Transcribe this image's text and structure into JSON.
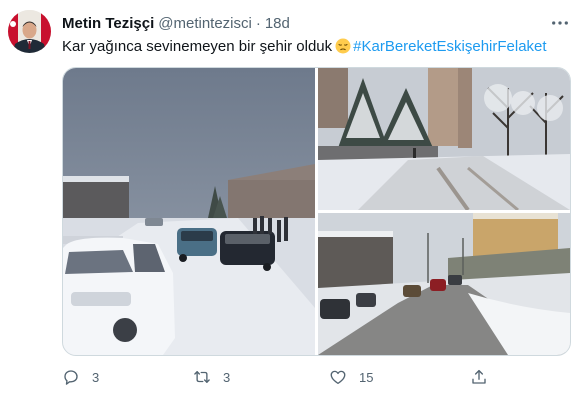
{
  "author": {
    "name": "Metin Tezişçi",
    "handle": "@metintezisci",
    "separator": "·",
    "time": "18d"
  },
  "tweet": {
    "text": "Kar yağınca sevinemeyen bir şehir olduk",
    "emoji": "pensive-face",
    "hashtag": "#KarBereketEskişehirFelaket"
  },
  "media": {
    "count": 3,
    "photos": [
      "snowy-road-cars-photo",
      "snowy-street-trees-photo",
      "snowy-road-traffic-photo"
    ]
  },
  "actions": {
    "reply_count": "3",
    "retweet_count": "3",
    "like_count": "15"
  },
  "colors": {
    "accent": "#1d9bf0",
    "secondary_text": "#536471",
    "primary_text": "#0f1419"
  }
}
